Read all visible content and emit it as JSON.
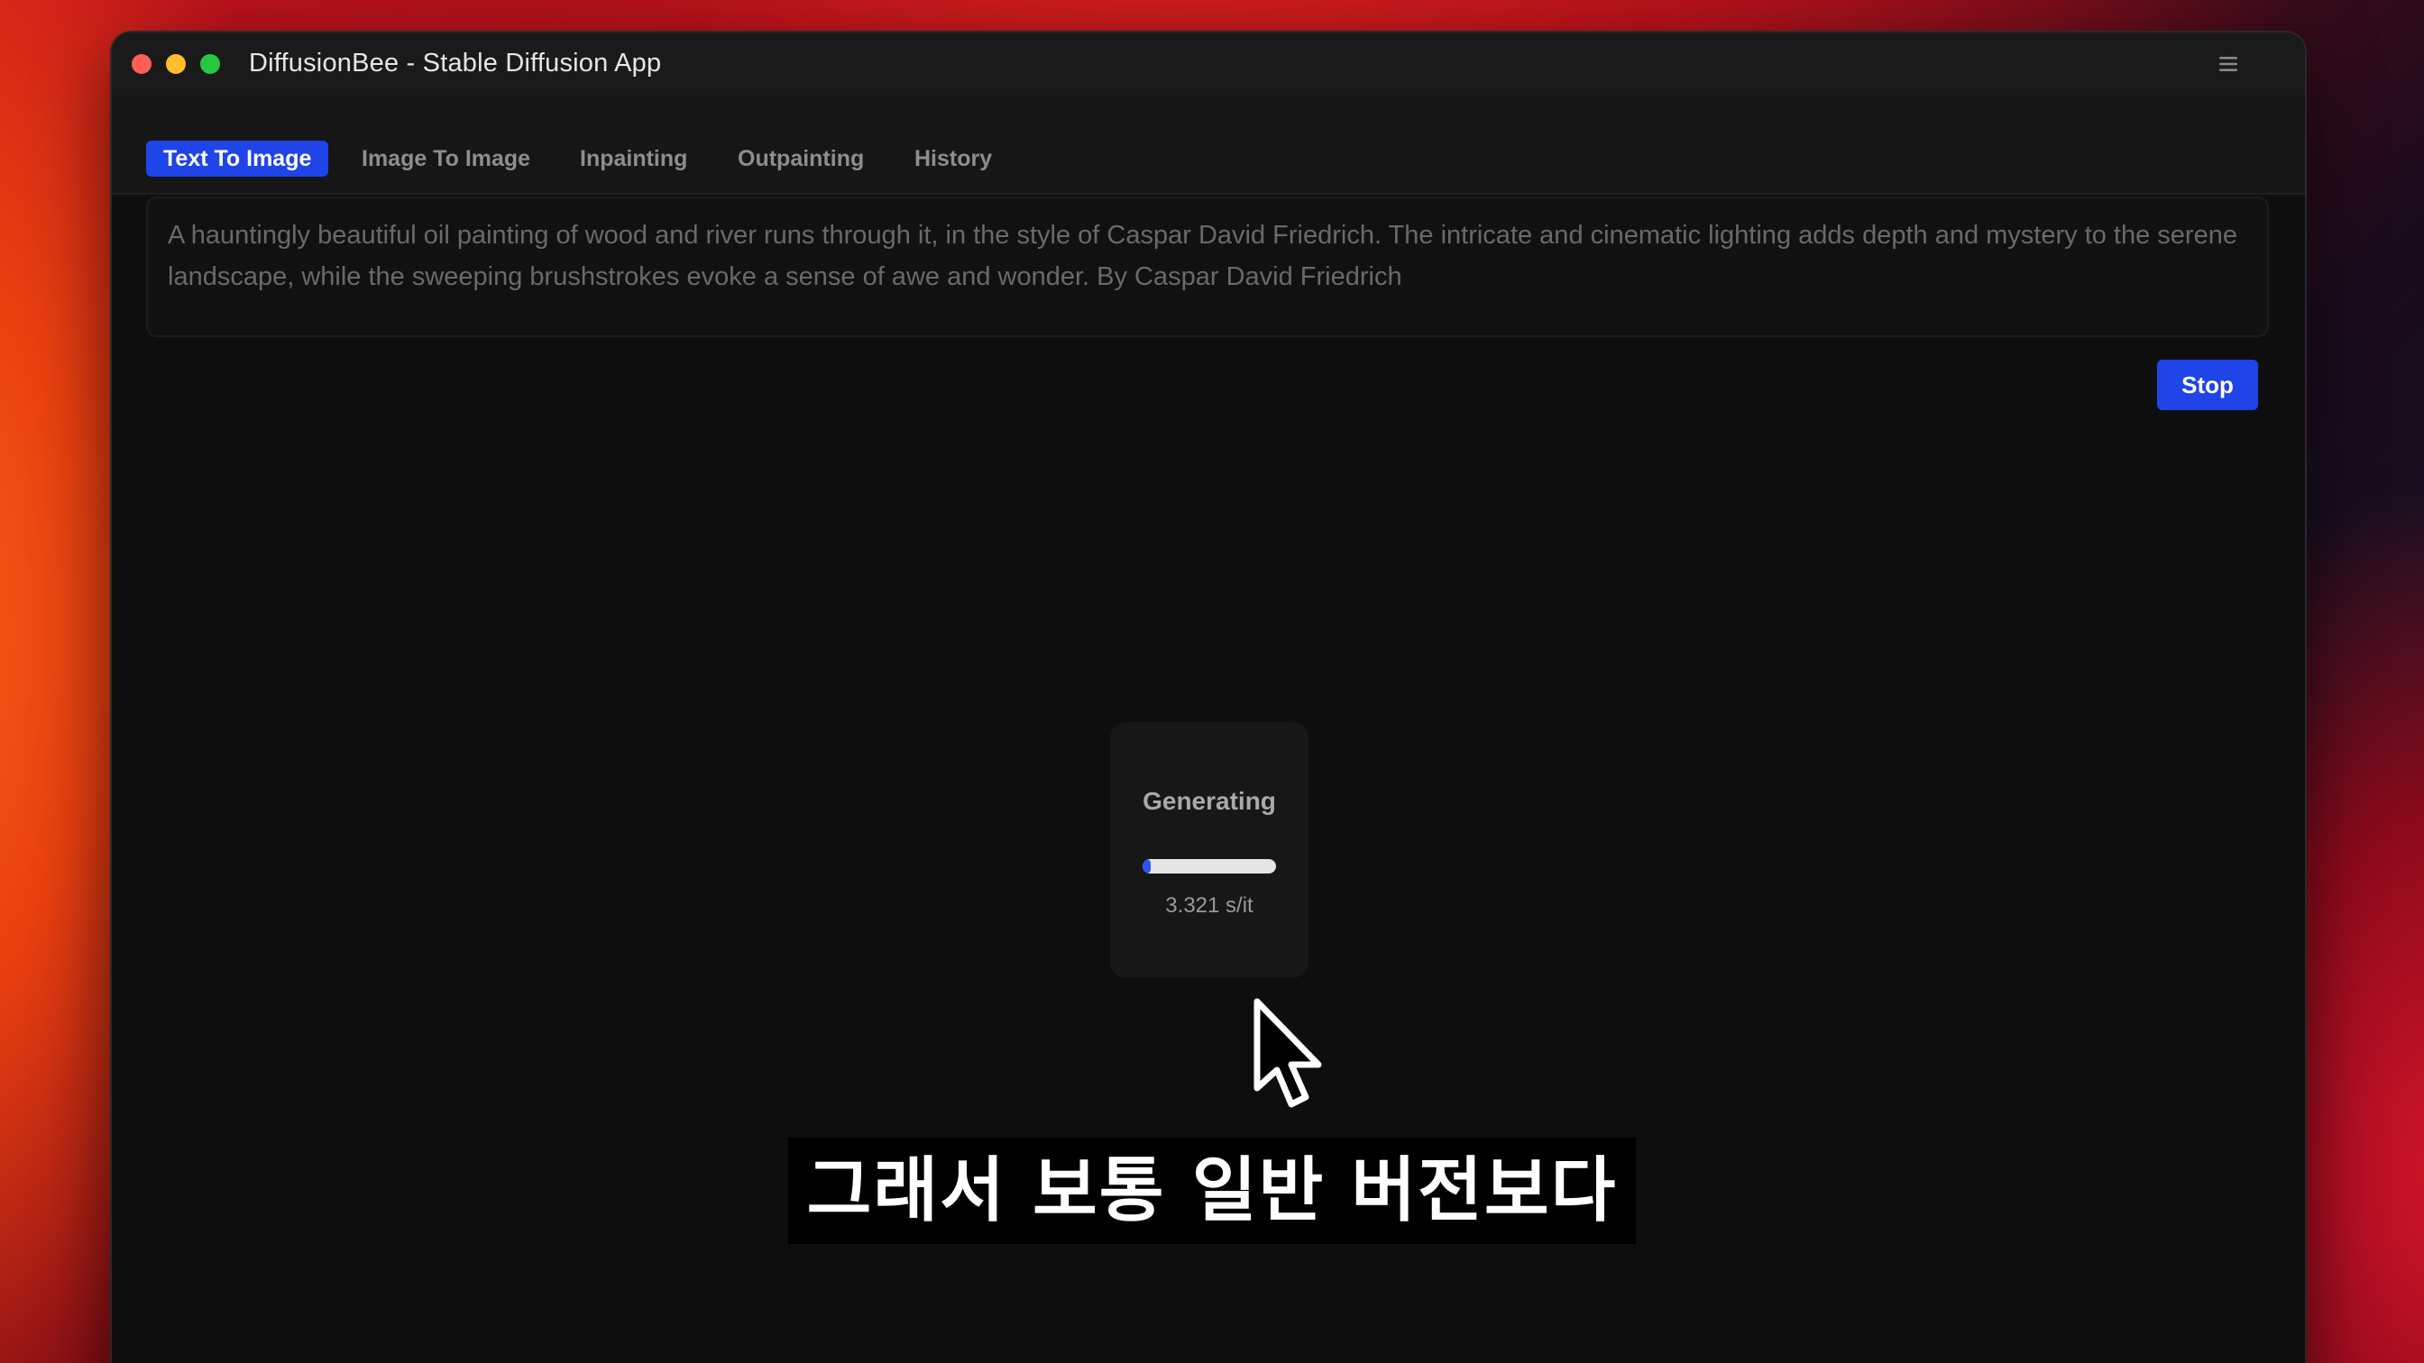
{
  "window": {
    "title": "DiffusionBee - Stable Diffusion App",
    "menu_icon": "hamburger-menu-icon"
  },
  "tabs": [
    {
      "label": "Text To Image",
      "active": true
    },
    {
      "label": "Image To Image",
      "active": false
    },
    {
      "label": "Inpainting",
      "active": false
    },
    {
      "label": "Outpainting",
      "active": false
    },
    {
      "label": "History",
      "active": false
    }
  ],
  "prompt": {
    "value": "A hauntingly beautiful oil painting of wood and river runs through it, in the style of Caspar David Friedrich. The intricate and cinematic lighting adds depth and mystery to the serene landscape, while the sweeping brushstrokes evoke a sense of awe and wonder. By Caspar David Friedrich"
  },
  "actions": {
    "stop_label": "Stop"
  },
  "progress": {
    "status": "Generating",
    "fraction": 0.06,
    "rate": "3.321 s/it"
  },
  "subtitle": {
    "text": "그래서 보통 일반 버전보다"
  },
  "colors": {
    "accent": "#1f44e8",
    "window_bg": "#0e0e0e",
    "titlebar_bg": "#1a1a1a",
    "traffic_red": "#fe5f57",
    "traffic_yellow": "#febc2e",
    "traffic_green": "#28c840"
  }
}
